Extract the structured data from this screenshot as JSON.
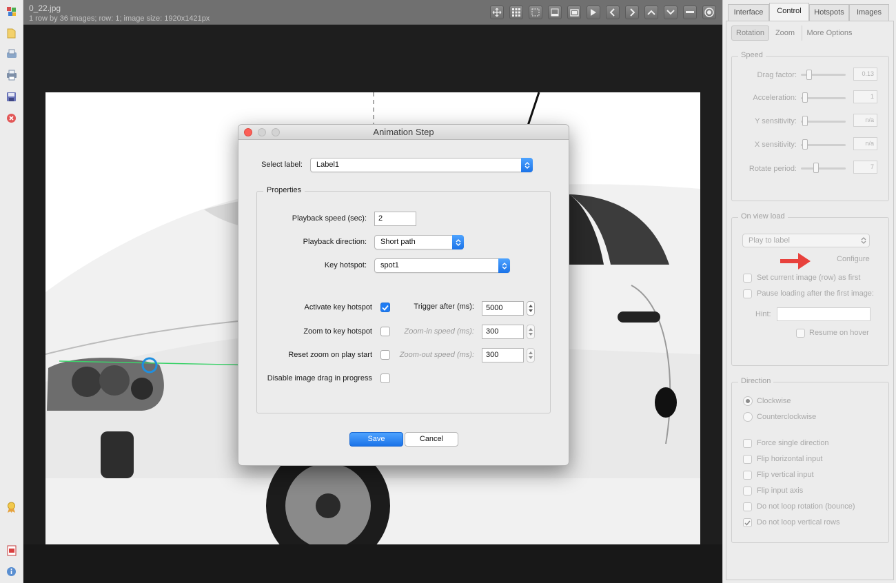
{
  "app": {
    "file_name": "0_22.jpg",
    "file_info": "1 row by 36 images; row: 1; image size: 1920x1421px"
  },
  "toolbar": {
    "left_icons": [
      "app-icon",
      "open-folder-icon",
      "export-icon",
      "print-icon",
      "save-icon",
      "close-red-icon",
      "ribbon-icon",
      "pdf-icon",
      "info-icon"
    ],
    "viewer_icons": [
      "move-icon",
      "grid-icon",
      "selection-icon",
      "panel-icon",
      "fullscreen-icon",
      "play-icon",
      "prev-icon",
      "next-icon",
      "up-icon",
      "down-icon",
      "minus-icon",
      "target-icon"
    ]
  },
  "dialog": {
    "title": "Animation Step",
    "select_label": "Select label:",
    "selected_label": "Label1",
    "properties_title": "Properties",
    "playback_speed_label": "Playback speed (sec):",
    "playback_speed_value": "2",
    "playback_direction_label": "Playback direction:",
    "playback_direction_value": "Short path",
    "key_hotspot_label": "Key hotspot:",
    "key_hotspot_value": "spot1",
    "activate_key_hotspot_label": "Activate key hotspot",
    "activate_key_hotspot_checked": true,
    "trigger_after_label": "Trigger after (ms):",
    "trigger_after_value": "5000",
    "zoom_to_hotspot_label": "Zoom to key hotspot",
    "zoom_to_hotspot_checked": false,
    "zoom_in_speed_label": "Zoom-in speed (ms):",
    "zoom_in_speed_value": "300",
    "reset_zoom_label": "Reset zoom on play start",
    "reset_zoom_checked": false,
    "zoom_out_speed_label": "Zoom-out speed (ms):",
    "zoom_out_speed_value": "300",
    "disable_drag_label": "Disable image drag in progress",
    "disable_drag_checked": false,
    "save_button": "Save",
    "cancel_button": "Cancel"
  },
  "right_panel": {
    "tabs": [
      "Interface",
      "Control",
      "Hotspots",
      "Images"
    ],
    "active_tab": "Control",
    "subtabs": [
      "Rotation",
      "Zoom",
      "More Options"
    ],
    "active_subtab": "Rotation",
    "speed": {
      "title": "Speed",
      "rows": [
        {
          "label": "Drag factor:",
          "value": "0.13"
        },
        {
          "label": "Acceleration:",
          "value": "1"
        },
        {
          "label": "Y sensitivity:",
          "value": "n/a"
        },
        {
          "label": "X sensitivity:",
          "value": "n/a"
        },
        {
          "label": "Rotate period:",
          "value": "7"
        }
      ]
    },
    "on_view_load": {
      "title": "On view load",
      "select_value": "Play to label",
      "configure_link": "Configure",
      "set_first_label": "Set current image (row) as first",
      "pause_loading_label": "Pause loading after the first image:",
      "hint_label": "Hint:",
      "hint_value": "",
      "resume_hover_label": "Resume on hover"
    },
    "direction": {
      "title": "Direction",
      "clockwise_label": "Clockwise",
      "counterclockwise_label": "Counterclockwise",
      "selected": "Clockwise",
      "options": [
        {
          "label": "Force single direction",
          "checked": false
        },
        {
          "label": "Flip horizontal input",
          "checked": false
        },
        {
          "label": "Flip vertical input",
          "checked": false
        },
        {
          "label": "Flip input axis",
          "checked": false
        },
        {
          "label": "Do not loop rotation (bounce)",
          "checked": false
        },
        {
          "label": "Do not loop vertical rows",
          "checked": true
        }
      ]
    }
  },
  "colors": {
    "accent_blue": "#1f7cf3",
    "annotation_arrow": "#e8413c",
    "hotspot_ring": "#1e8fe0",
    "hotspot_line": "#3cd26a"
  }
}
